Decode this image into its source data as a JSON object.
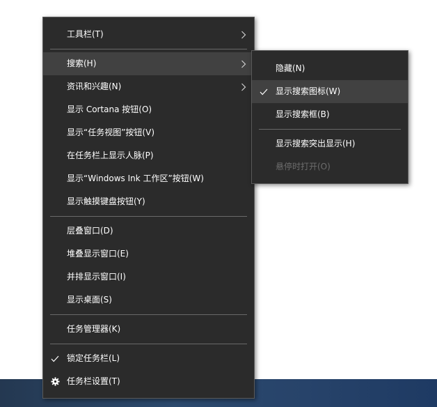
{
  "main_menu": {
    "items": [
      {
        "label": "工具栏(T)"
      },
      {
        "label": "搜索(H)"
      },
      {
        "label": "资讯和兴趣(N)"
      },
      {
        "label": "显示 Cortana 按钮(O)"
      },
      {
        "label": "显示“任务视图”按钮(V)"
      },
      {
        "label": "在任务栏上显示人脉(P)"
      },
      {
        "label": "显示“Windows Ink 工作区”按钮(W)"
      },
      {
        "label": "显示触摸键盘按钮(Y)"
      },
      {
        "label": "层叠窗口(D)"
      },
      {
        "label": "堆叠显示窗口(E)"
      },
      {
        "label": "并排显示窗口(I)"
      },
      {
        "label": "显示桌面(S)"
      },
      {
        "label": "任务管理器(K)"
      },
      {
        "label": "锁定任务栏(L)",
        "checked": true
      },
      {
        "label": "任务栏设置(T)",
        "icon": "gear-icon"
      }
    ]
  },
  "search_submenu": {
    "items": [
      {
        "label": "隐藏(N)"
      },
      {
        "label": "显示搜索图标(W)",
        "checked": true
      },
      {
        "label": "显示搜索框(B)"
      },
      {
        "label": "显示搜索突出显示(H)"
      },
      {
        "label": "悬停时打开(O)",
        "disabled": true
      }
    ]
  },
  "colors": {
    "menu_background": "#2b2b2b",
    "menu_border": "#5a5a5a",
    "highlight": "#414141",
    "text": "#ffffff",
    "disabled_text": "#6d6d6d",
    "separator": "#6a6a6a",
    "taskbar": "#2c4a6e"
  }
}
